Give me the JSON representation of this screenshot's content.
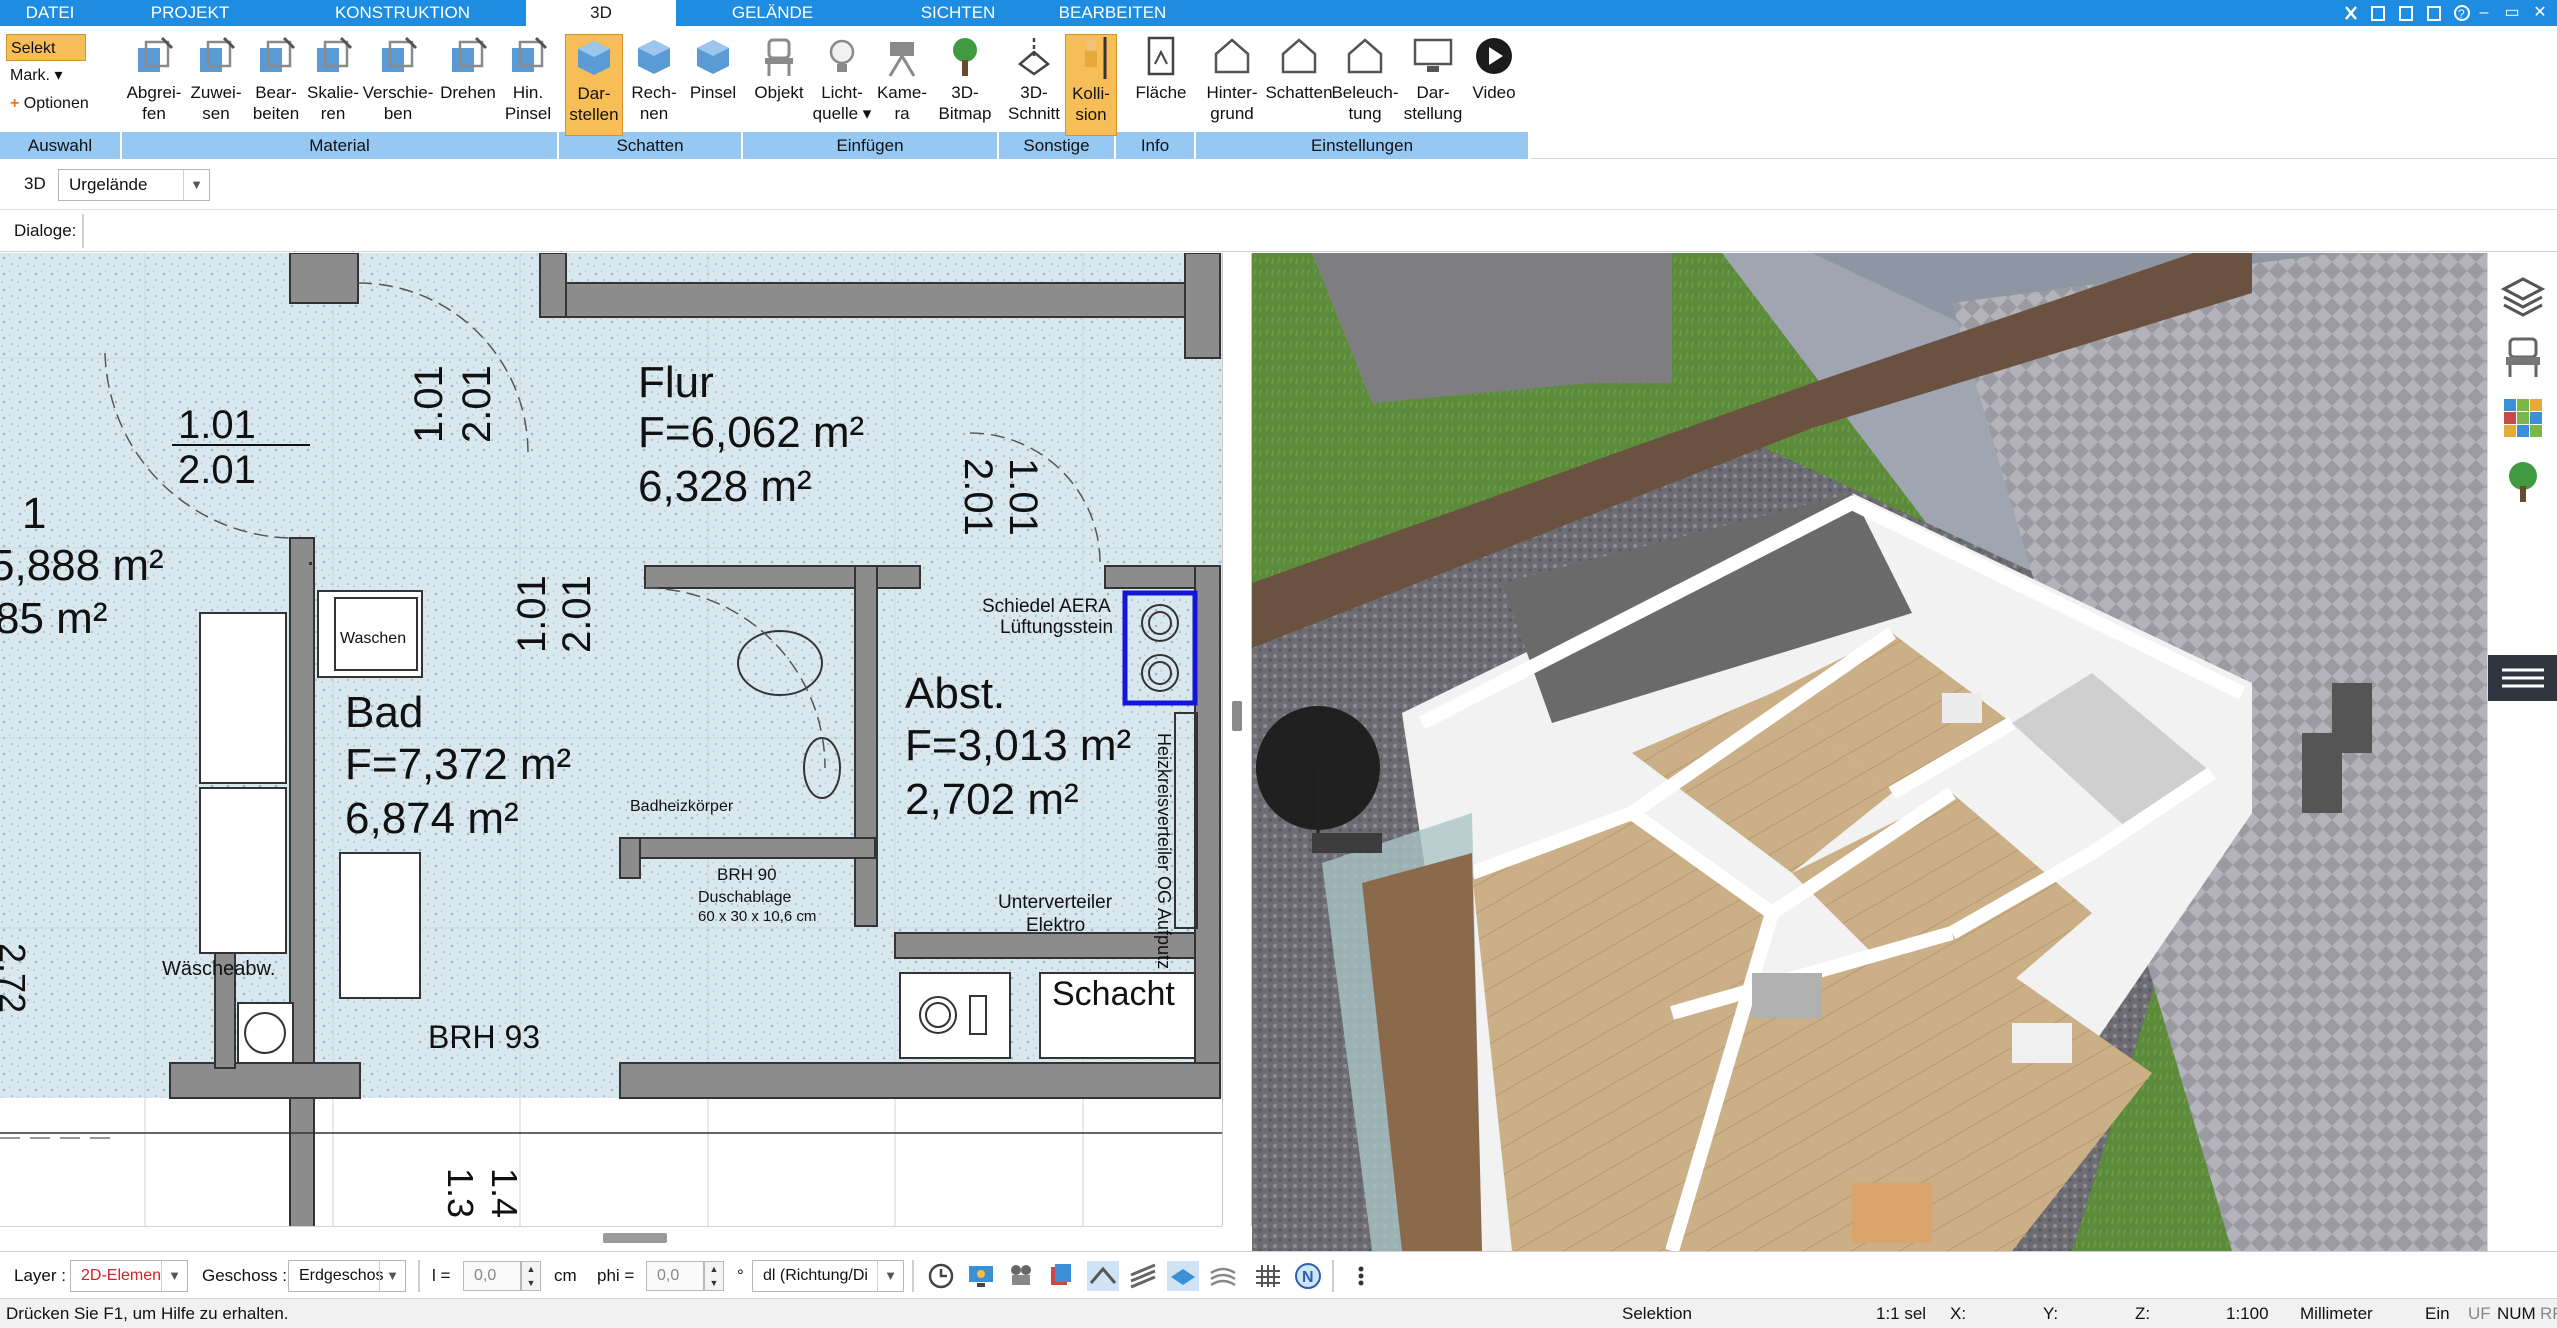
{
  "menu": {
    "tabs": [
      "DATEI",
      "PROJEKT",
      "KONSTRUKTION",
      "3D",
      "GELÄNDE",
      "SICHTEN",
      "BEARBEITEN"
    ],
    "active": "3D"
  },
  "ribbon": {
    "auswahl": {
      "select": "Selekt",
      "mark": "Mark. ▾",
      "options": "Optionen",
      "group": "Auswahl"
    },
    "material": {
      "group": "Material",
      "buttons": [
        {
          "l1": "Abgrei-",
          "l2": "fen"
        },
        {
          "l1": "Zuwei-",
          "l2": "sen"
        },
        {
          "l1": "Bear-",
          "l2": "beiten"
        },
        {
          "l1": "Skalie-",
          "l2": "ren"
        },
        {
          "l1": "Verschie-",
          "l2": "ben"
        },
        {
          "l1": "Drehen",
          "l2": ""
        },
        {
          "l1": "Hin.",
          "l2": "Pinsel"
        }
      ]
    },
    "schatten": {
      "group": "Schatten",
      "buttons": [
        {
          "l1": "Dar-",
          "l2": "stellen"
        },
        {
          "l1": "Rech-",
          "l2": "nen"
        },
        {
          "l1": "Pinsel",
          "l2": ""
        }
      ]
    },
    "einfuegen": {
      "group": "Einfügen",
      "buttons": [
        {
          "l1": "Objekt",
          "l2": ""
        },
        {
          "l1": "Licht-",
          "l2": "quelle ▾"
        },
        {
          "l1": "Kame-",
          "l2": "ra"
        },
        {
          "l1": "3D-",
          "l2": "Bitmap"
        }
      ]
    },
    "sonstige": {
      "group": "Sonstige",
      "buttons": [
        {
          "l1": "3D-",
          "l2": "Schnitt"
        },
        {
          "l1": "Kolli-",
          "l2": "sion"
        }
      ]
    },
    "info": {
      "group": "Info",
      "buttons": [
        {
          "l1": "Fläche",
          "l2": ""
        }
      ]
    },
    "einstellungen": {
      "group": "Einstellungen",
      "buttons": [
        {
          "l1": "Hinter-",
          "l2": "grund"
        },
        {
          "l1": "Schatten",
          "l2": ""
        },
        {
          "l1": "Beleuch-",
          "l2": "tung"
        },
        {
          "l1": "Dar-",
          "l2": "stellung"
        },
        {
          "l1": "Video",
          "l2": ""
        }
      ]
    }
  },
  "toolbar": {
    "mode": "3D",
    "terrain": "Urgelände",
    "dialogs": "Dialoge:"
  },
  "plan": {
    "rooms": [
      {
        "name": "Flur",
        "area1": "F=6,062 m²",
        "area2": "6,328 m²"
      },
      {
        "name": "Bad",
        "area1": "F=7,372 m²",
        "area2": "6,874 m²"
      },
      {
        "name": "Abst.",
        "area1": "F=3,013 m²",
        "area2": "2,702 m²"
      },
      {
        "name": "1",
        "area1": "5,888 m²",
        "area2": "85 m²"
      }
    ],
    "door_dims": {
      "d1": "1.01",
      "d2": "2.01"
    },
    "labels": {
      "waschen": "Waschen",
      "badheizkoerper": "Badheizkörper",
      "brh90": "BRH 90",
      "duschablage": "Duschablage",
      "dusch_dims": "60 x 30 x 10,6 cm",
      "unterverteiler1": "Unterverteiler",
      "unterverteiler2": "Elektro",
      "schacht": "Schacht",
      "schiedel1": "Schiedel AERA",
      "schiedel2": "Lüftungsstein",
      "heizkreis": "Heizkreisverteiler OG Aufputz",
      "waescheabw": "Wäscheabw.",
      "brh93": "BRH 93",
      "dim_bottom1": "1.3",
      "dim_bottom2": "1.4",
      "dim_left": "2.72"
    }
  },
  "bottombar": {
    "layer_label": "Layer :",
    "layer_value": "2D-Elemen",
    "geschoss_label": "Geschoss :",
    "geschoss_value": "Erdgeschos",
    "l_label": "l =",
    "l_value": "0,0",
    "unit": "cm",
    "phi_label": "phi =",
    "phi_value": "0,0",
    "deg": "°",
    "direction": "dl (Richtung/Di"
  },
  "statusbar": {
    "help": "Drücken Sie F1, um Hilfe zu erhalten.",
    "mode": "Selektion",
    "sel": "1:1 sel",
    "x": "X:",
    "y": "Y:",
    "z": "Z:",
    "scale": "1:100",
    "unit": "Millimeter",
    "ein": "Ein",
    "uf": "UF",
    "num": "NUM",
    "rf": "RF"
  },
  "colors": {
    "accent": "#1e8ce0",
    "group": "#96c8f2",
    "active_btn": "#f7be57",
    "floor_tile": "#dce9ef",
    "wall": "#8a8a8a",
    "grass": "#5a8a3b",
    "floor_wood": "#c9ae84"
  }
}
